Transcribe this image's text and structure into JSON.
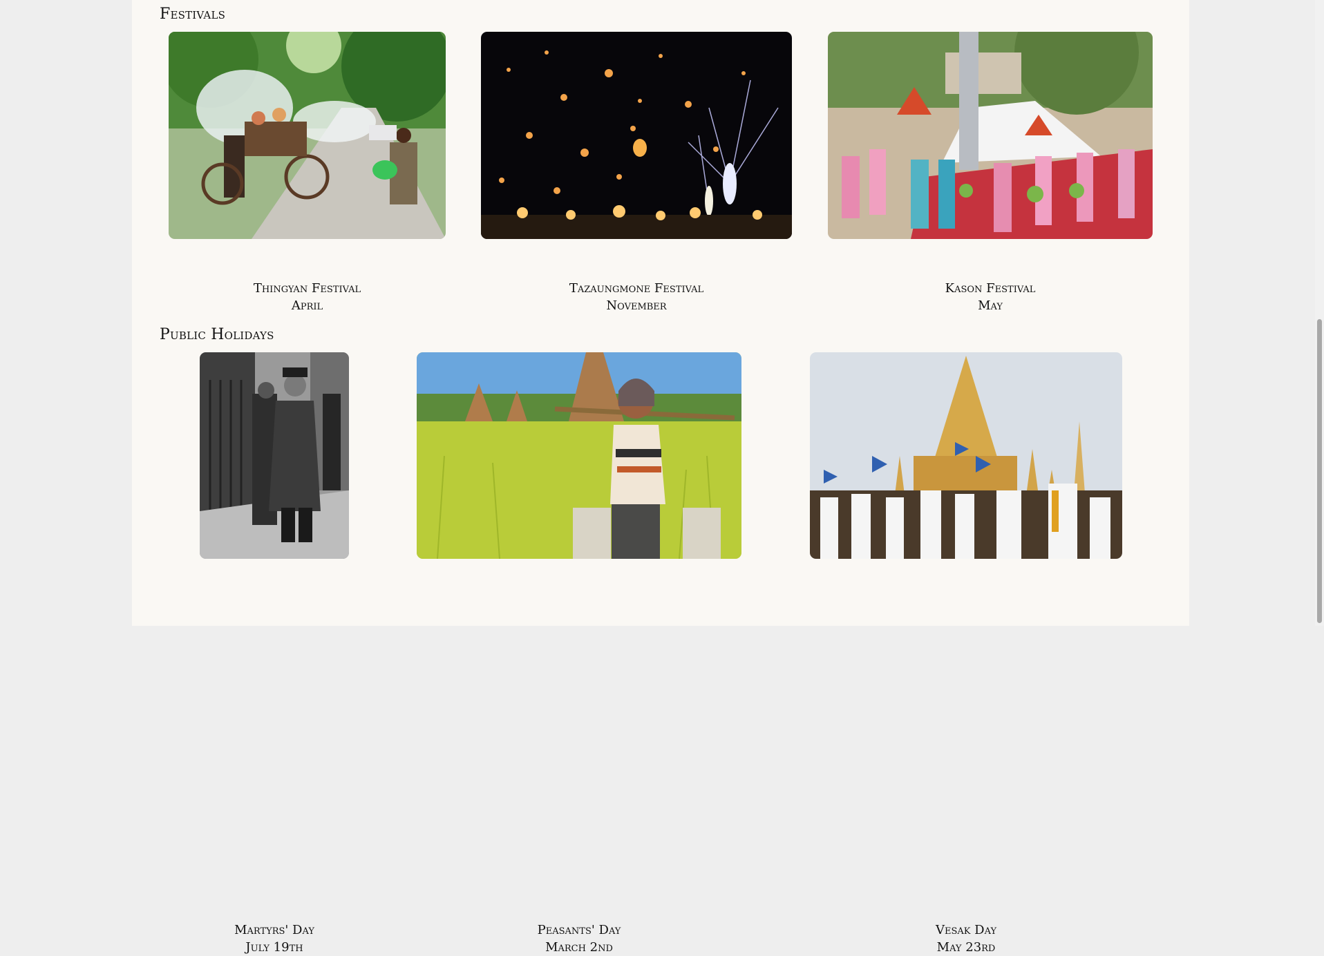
{
  "festivals": {
    "title": "Festivals",
    "items": [
      {
        "name": "Thingyan Festival",
        "date": "April"
      },
      {
        "name": "Tazaungmone Festival",
        "date": "November"
      },
      {
        "name": "Kason Festival",
        "date": "May"
      }
    ]
  },
  "holidays": {
    "title": "Public Holidays",
    "items": [
      {
        "name": "Martyrs' Day",
        "date": "July 19th"
      },
      {
        "name": "Peasants' Day",
        "date": "March 2nd"
      },
      {
        "name": "Vesak Day",
        "date": "May 23rd"
      }
    ]
  }
}
